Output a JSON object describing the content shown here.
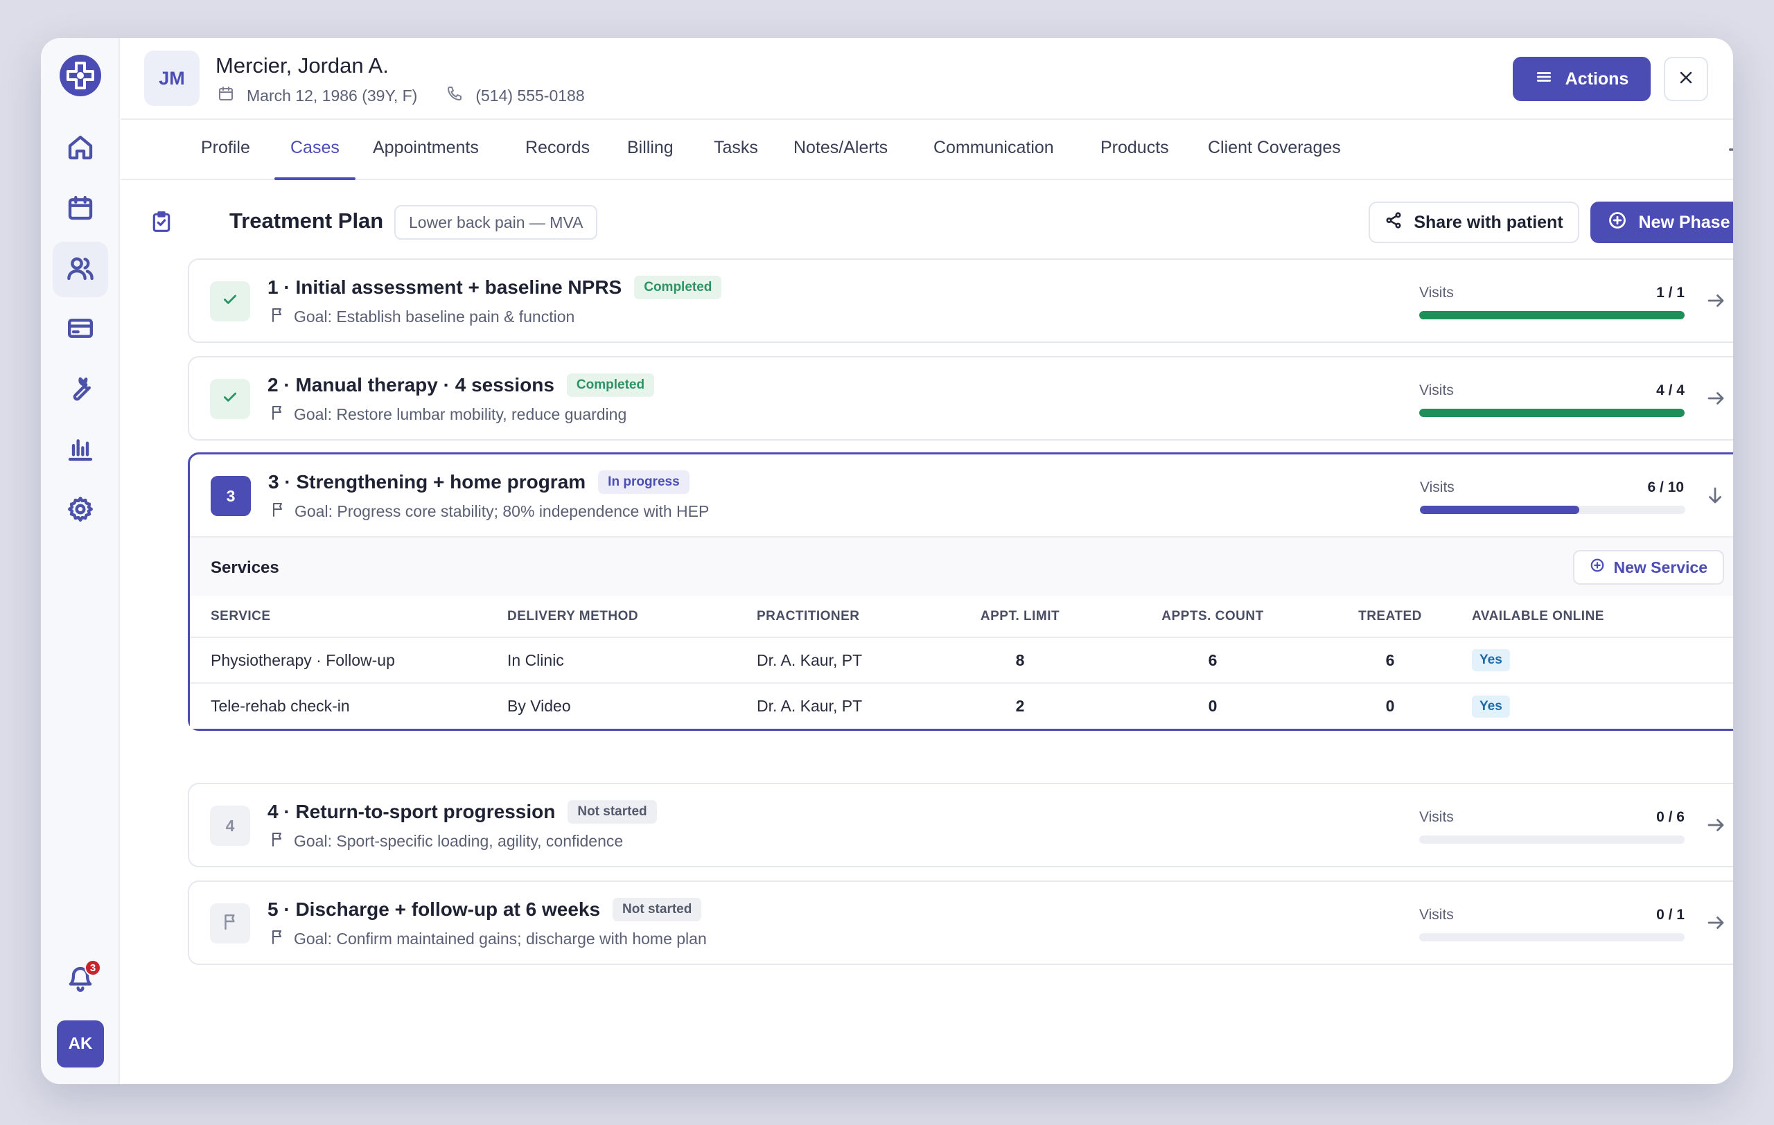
{
  "patient": {
    "initials": "JM",
    "name": "Mercier, Jordan A.",
    "dob": "March 12, 1986 (39Y, F)",
    "phone": "(514) 555-0188"
  },
  "header": {
    "actions_label": "Actions"
  },
  "sidebar": {
    "items": [
      "home-icon",
      "calendar-icon",
      "users-icon",
      "card-icon",
      "tools-icon",
      "chart-icon",
      "gear-icon"
    ],
    "active": "users-icon",
    "notification_count": "3",
    "user_initials": "AK"
  },
  "tabs": [
    "Profile",
    "Cases",
    "Appointments",
    "Records",
    "Billing",
    "Tasks",
    "Notes/Alerts",
    "Communication",
    "Products",
    "Client Coverages"
  ],
  "active_tab": "Cases",
  "plan": {
    "title": "Treatment Plan",
    "case": "Lower back pain — MVA",
    "share_label": "Share with patient",
    "new_phase_label": "New Phase"
  },
  "colors": {
    "accent": "#4b4db5",
    "completed": "#2c9363",
    "progress_fill": "#4b4db5",
    "done_fill": "#1f8f5a"
  },
  "phases": [
    {
      "badge": "",
      "status_kind": "done",
      "title": "1 · Initial assessment + baseline NPRS",
      "status": "Completed",
      "goal": "Goal: Establish baseline pain & function",
      "visits_label": "Visits",
      "visits": "1 / 1",
      "progress": 1.0
    },
    {
      "badge": "",
      "status_kind": "done",
      "title": "2 · Manual therapy · 4 sessions",
      "status": "Completed",
      "goal": "Goal: Restore lumbar mobility, reduce guarding",
      "visits_label": "Visits",
      "visits": "4 / 4",
      "progress": 1.0
    },
    {
      "badge": "3",
      "status_kind": "current",
      "title": "3 · Strengthening + home program",
      "status": "In progress",
      "goal": "Goal: Progress core stability; 80% independence with HEP",
      "visits_label": "Visits",
      "visits": "6 / 10",
      "progress": 0.6
    },
    {
      "badge": "4",
      "status_kind": "pending",
      "title": "4 · Return-to-sport progression",
      "status": "Not started",
      "goal": "Goal: Sport-specific loading, agility, confidence",
      "visits_label": "Visits",
      "visits": "0 / 6",
      "progress": 0.0
    },
    {
      "badge": "",
      "status_kind": "flag",
      "title": "5 · Discharge + follow-up at 6 weeks",
      "status": "Not started",
      "goal": "Goal: Confirm maintained gains; discharge with home plan",
      "visits_label": "Visits",
      "visits": "0 / 1",
      "progress": 0.0
    }
  ],
  "services": {
    "title": "Services",
    "new_service_label": "New Service",
    "columns": [
      "SERVICE",
      "DELIVERY METHOD",
      "PRACTITIONER",
      "APPT. LIMIT",
      "APPTS. COUNT",
      "TREATED",
      "AVAILABLE ONLINE"
    ],
    "rows": [
      [
        "Physiotherapy · Follow-up",
        "In Clinic",
        "Dr. A. Kaur, PT",
        "8",
        "6",
        "6",
        "Yes"
      ],
      [
        "Tele-rehab check-in",
        "By Video",
        "Dr. A. Kaur, PT",
        "2",
        "0",
        "0",
        "Yes"
      ]
    ]
  }
}
